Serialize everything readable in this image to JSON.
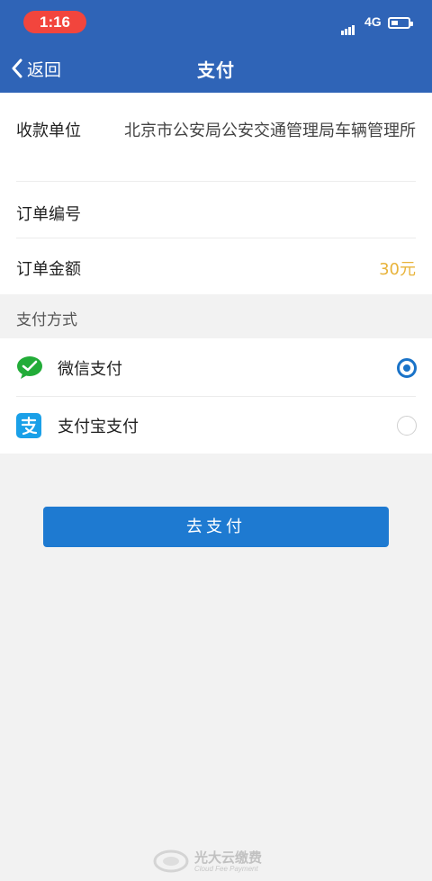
{
  "status_bar": {
    "time": "1:16",
    "network": "4G"
  },
  "nav": {
    "back_label": "返回",
    "title": "支付"
  },
  "order": {
    "payee_label": "收款单位",
    "payee_value": "北京市公安局公安交通管理局车辆管理所",
    "number_label": "订单编号",
    "number_value": "",
    "amount_label": "订单金额",
    "amount_value": "30元"
  },
  "payment": {
    "section_title": "支付方式",
    "methods": [
      {
        "label": "微信支付",
        "icon": "wechat-icon",
        "selected": true
      },
      {
        "label": "支付宝支付",
        "icon": "alipay-icon",
        "selected": false
      }
    ]
  },
  "actions": {
    "pay_label": "去支付"
  },
  "footer": {
    "brand": "光大云缴费",
    "brand_sub": "Cloud Fee Payment"
  },
  "colors": {
    "header": "#2f64b7",
    "button": "#1e7ad1",
    "amount": "#e8b33a",
    "wechat": "#22ac38",
    "alipay": "#1aa0e8"
  }
}
